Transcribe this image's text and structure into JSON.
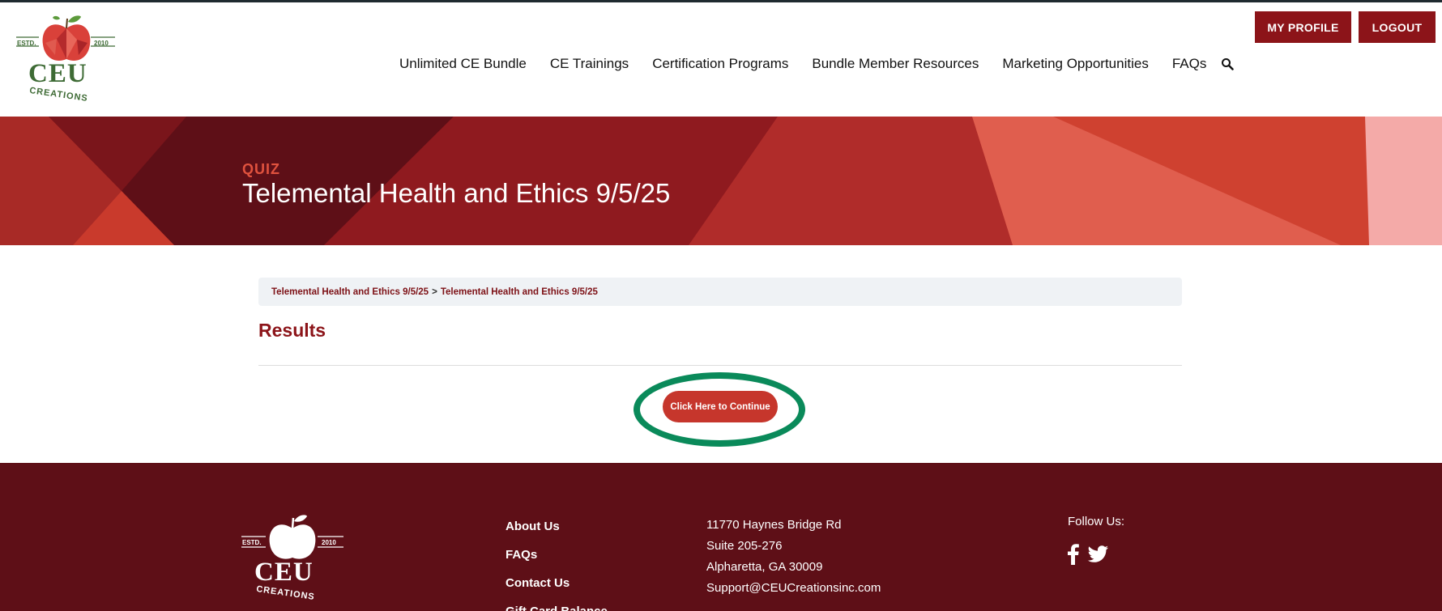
{
  "header": {
    "logo": {
      "estd": "ESTD.",
      "year": "2010",
      "name": "CEU",
      "tagline": "CREATIONS"
    },
    "nav": [
      {
        "label": "Unlimited CE Bundle"
      },
      {
        "label": "CE Trainings"
      },
      {
        "label": "Certification Programs"
      },
      {
        "label": "Bundle Member Resources"
      },
      {
        "label": "Marketing Opportunities"
      },
      {
        "label": "FAQs"
      }
    ],
    "search_icon": "search-icon",
    "my_profile_label": "MY PROFILE",
    "logout_label": "LOGOUT"
  },
  "hero": {
    "kicker": "QUIZ",
    "title": "Telemental Health and Ethics 9/5/25"
  },
  "breadcrumb": {
    "items": [
      "Telemental Health and Ethics 9/5/25",
      "Telemental Health and Ethics 9/5/25"
    ],
    "separator": ">"
  },
  "main": {
    "results_heading": "Results",
    "continue_label": "Click Here to Continue"
  },
  "footer": {
    "logo": {
      "estd": "ESTD.",
      "year": "2010",
      "name": "CEU",
      "tagline": "CREATIONS"
    },
    "links": [
      {
        "label": "About Us"
      },
      {
        "label": "FAQs"
      },
      {
        "label": "Contact Us"
      },
      {
        "label": "Gift Card Balance"
      }
    ],
    "address": {
      "line1": "11770 Haynes Bridge Rd",
      "line2": "Suite 205-276",
      "line3": "Alpharetta, GA 30009",
      "email": "Support@CEUCreationsinc.com"
    },
    "follow_label": "Follow Us:",
    "social_icons": [
      "facebook-icon",
      "twitter-icon"
    ]
  },
  "colors": {
    "brand_red": "#8c1419",
    "button_red": "#c6362c",
    "footer_bg": "#5e0f17",
    "logo_green": "#3e6b35",
    "highlight_ring": "#0a8a5a"
  }
}
